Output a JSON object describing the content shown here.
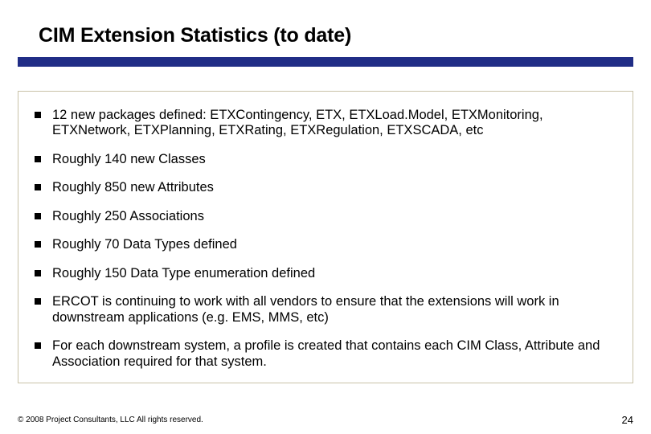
{
  "title": "CIM Extension Statistics (to date)",
  "bullets": [
    "12 new packages defined: ETXContingency, ETX, ETXLoad.Model, ETXMonitoring, ETXNetwork, ETXPlanning, ETXRating, ETXRegulation, ETXSCADA, etc",
    "Roughly 140 new Classes",
    "Roughly 850 new Attributes",
    "Roughly 250 Associations",
    "Roughly 70 Data Types defined",
    "Roughly 150 Data Type enumeration defined",
    "ERCOT is continuing to work with all vendors to ensure that the extensions will work in downstream applications (e.g. EMS, MMS, etc)",
    "For each downstream system, a profile is created that contains each CIM Class, Attribute and Association required for that system."
  ],
  "footer": "© 2008 Project Consultants, LLC All rights reserved.",
  "page_number": "24"
}
